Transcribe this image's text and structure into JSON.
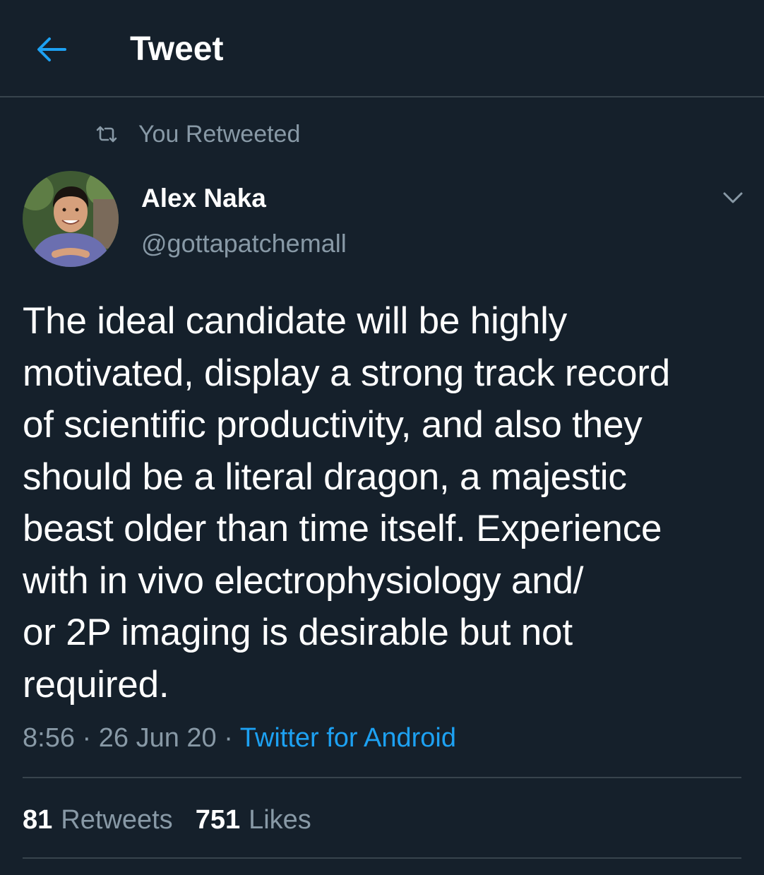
{
  "header": {
    "back_icon": "arrow-left-icon",
    "title": "Tweet"
  },
  "retweet_context": {
    "icon": "retweet-icon",
    "text": "You Retweeted"
  },
  "author": {
    "display_name": "Alex Naka",
    "handle": "@gottapatchemall"
  },
  "more_icon": "chevron-down-icon",
  "tweet": {
    "text": "The ideal candidate will be highly\nmotivated, display a strong track record\nof scientific productivity, and also they\nshould be a literal dragon, a majestic\nbeast older than time itself. Experience\nwith in vivo electrophysiology and/\nor 2P imaging is desirable but not\nrequired.",
    "time": "8:56",
    "date": "26 Jun 20",
    "separator": "·",
    "source": "Twitter for Android"
  },
  "stats": {
    "retweets_count": "81",
    "retweets_label": "Retweets",
    "likes_count": "751",
    "likes_label": "Likes"
  },
  "colors": {
    "background": "#15202b",
    "accent": "#1da1f2",
    "secondary_text": "#8899a6",
    "divider": "#38444d"
  }
}
